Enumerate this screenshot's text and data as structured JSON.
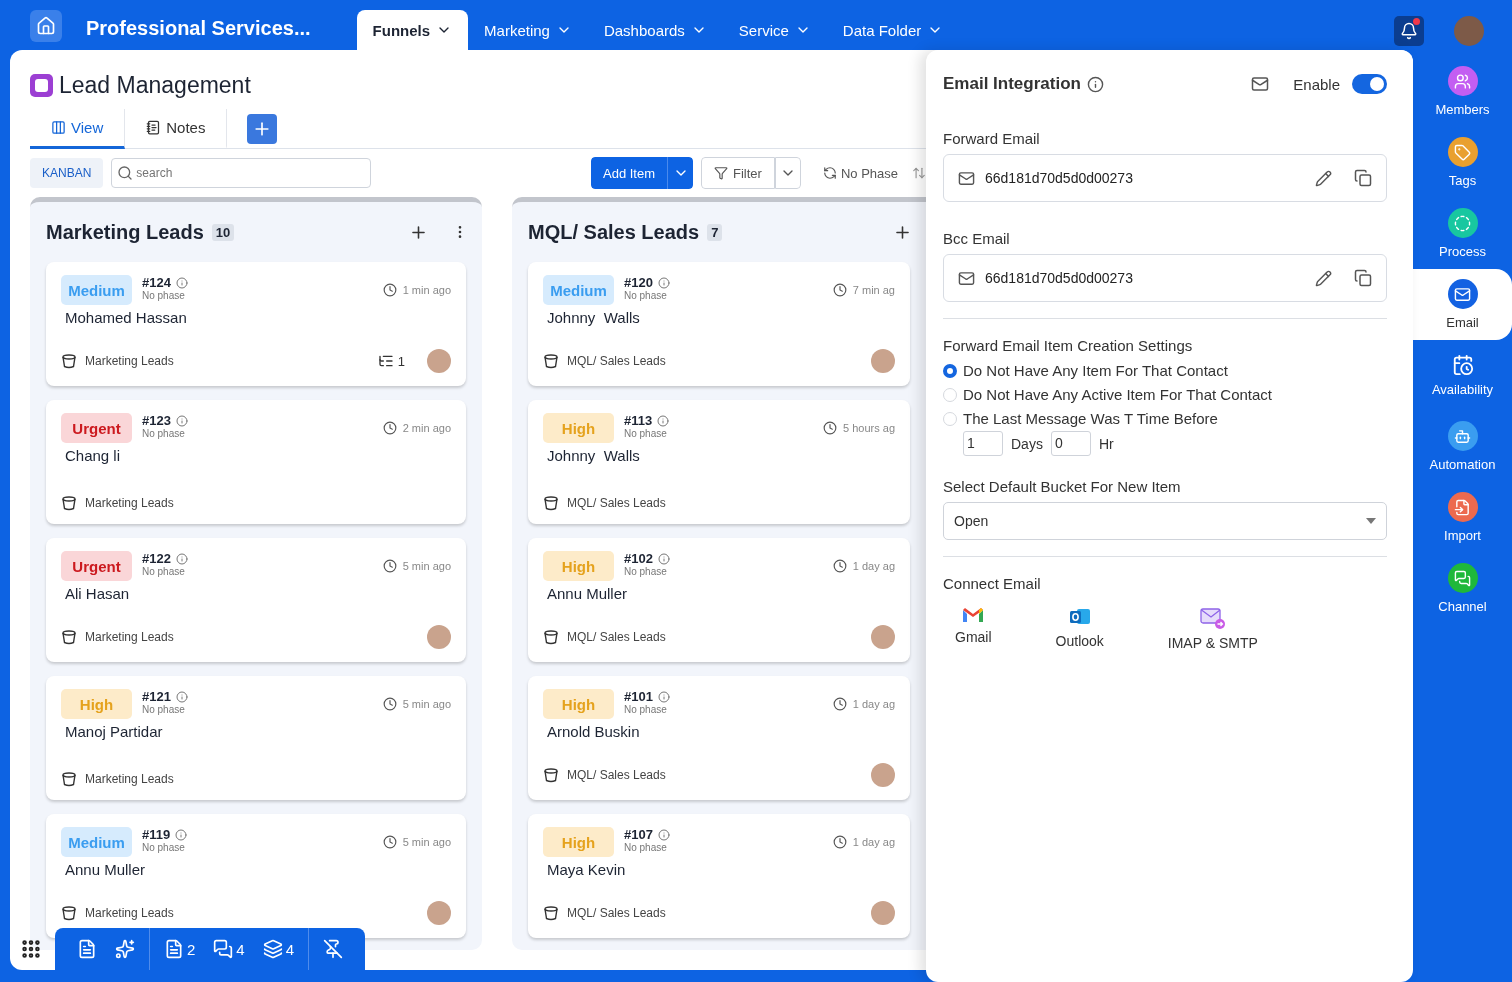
{
  "nav": {
    "workspace": "Professional Services...",
    "unread": true,
    "tabs": [
      {
        "label": "Funnels",
        "selected": true
      },
      {
        "label": "Marketing",
        "selected": false
      },
      {
        "label": "Dashboards",
        "selected": false
      },
      {
        "label": "Service",
        "selected": false
      },
      {
        "label": "Data Folder",
        "selected": false
      }
    ]
  },
  "page": {
    "title": "Lead Management",
    "tabs": [
      {
        "label": "View",
        "kind": "view",
        "selected": true
      },
      {
        "label": "Notes",
        "kind": "notes",
        "selected": false
      }
    ]
  },
  "toolbar": {
    "view_mode": "KANBAN",
    "search": {
      "placeholder": "search"
    },
    "add_item": "Add Item",
    "filter": "Filter",
    "phase": "No Phase"
  },
  "columns": [
    {
      "title": "Marketing Leads",
      "count": "10",
      "has_menu": true,
      "cards": [
        {
          "priority": "Medium",
          "kind": "medium",
          "number": "#124",
          "phase": "No phase",
          "name": "Mohamed Hassan",
          "time": "1 min ago",
          "bucket": "Marketing Leads",
          "subitems": "1",
          "assigned": true
        },
        {
          "priority": "Urgent",
          "kind": "urgent",
          "number": "#123",
          "phase": "No phase",
          "name": "Chang li",
          "time": "2 min ago",
          "bucket": "Marketing Leads",
          "assigned": false
        },
        {
          "priority": "Urgent",
          "kind": "urgent",
          "number": "#122",
          "phase": "No phase",
          "name": "Ali Hasan",
          "time": "5 min ago",
          "bucket": "Marketing Leads",
          "assigned": true
        },
        {
          "priority": "High",
          "kind": "high",
          "number": "#121",
          "phase": "No phase",
          "name": "Manoj Partidar",
          "time": "5 min ago",
          "bucket": "Marketing Leads",
          "assigned": false
        },
        {
          "priority": "Medium",
          "kind": "medium",
          "number": "#119",
          "phase": "No phase",
          "name": "Annu Muller",
          "time": "5 min ago",
          "bucket": "Marketing Leads",
          "assigned": true
        }
      ]
    },
    {
      "title": "MQL/ Sales Leads",
      "count": "7",
      "has_menu": false,
      "cards": [
        {
          "priority": "Medium",
          "kind": "medium",
          "number": "#120",
          "phase": "No phase",
          "name": "Johnny  Walls",
          "time": "7 min ag",
          "bucket": "MQL/ Sales Leads",
          "assigned": true
        },
        {
          "priority": "High",
          "kind": "high",
          "number": "#113",
          "phase": "No phase",
          "name": "Johnny  Walls",
          "time": "5 hours ag",
          "bucket": "MQL/ Sales Leads",
          "assigned": false
        },
        {
          "priority": "High",
          "kind": "high",
          "number": "#102",
          "phase": "No phase",
          "name": "Annu Muller",
          "time": "1 day ag",
          "bucket": "MQL/ Sales Leads",
          "assigned": true
        },
        {
          "priority": "High",
          "kind": "high",
          "number": "#101",
          "phase": "No phase",
          "name": "Arnold Buskin",
          "time": "1 day ag",
          "bucket": "MQL/ Sales Leads",
          "assigned": true
        },
        {
          "priority": "High",
          "kind": "high",
          "number": "#107",
          "phase": "No phase",
          "name": "Maya Kevin",
          "time": "1 day ag",
          "bucket": "MQL/ Sales Leads",
          "assigned": true
        }
      ]
    }
  ],
  "bottom_bar": {
    "documents": "2",
    "comments": "4",
    "layers": "4"
  },
  "email_panel": {
    "title": "Email Integration",
    "enable_label": "Enable",
    "enabled": true,
    "forward_email": {
      "label": "Forward Email",
      "value": "66d181d70d5d0d00273"
    },
    "bcc_email": {
      "label": "Bcc Email",
      "value": "66d181d70d5d0d00273"
    },
    "creation_settings": {
      "label": "Forward Email Item Creation Settings",
      "options": [
        {
          "label": "Do Not Have Any Item For That Contact",
          "selected": true
        },
        {
          "label": "Do Not Have Any Active Item For That Contact",
          "selected": false
        },
        {
          "label": "The Last Message Was T Time Before",
          "selected": false
        }
      ],
      "days": "1",
      "days_label": "Days",
      "hours": "0",
      "hours_label": "Hr"
    },
    "bucket": {
      "label": "Select Default Bucket For New Item",
      "value": "Open"
    },
    "connect": {
      "label": "Connect Email",
      "providers": [
        {
          "label": "Gmail",
          "kind": "gmail"
        },
        {
          "label": "Outlook",
          "kind": "outlook"
        },
        {
          "label": "IMAP & SMTP",
          "kind": "imap"
        }
      ]
    }
  },
  "sidebar": {
    "items": [
      {
        "label": "Members",
        "kind": "members",
        "color": "#c35ef2",
        "selected": false
      },
      {
        "label": "Tags",
        "kind": "tags",
        "color": "#e9a02f",
        "selected": false
      },
      {
        "label": "Process",
        "kind": "process",
        "color": "#18c7a0",
        "selected": false
      },
      {
        "label": "Email",
        "kind": "email",
        "color": "#1362e2",
        "selected": true
      },
      {
        "label": "Availability",
        "kind": "availability",
        "selected": false
      },
      {
        "label": "Automation",
        "kind": "automation",
        "color": "#3a9df0",
        "selected": false
      },
      {
        "label": "Import",
        "kind": "import",
        "color": "#ec6a4f",
        "selected": false
      },
      {
        "label": "Channel",
        "kind": "channel",
        "color": "#1fb83a",
        "selected": false
      }
    ]
  }
}
